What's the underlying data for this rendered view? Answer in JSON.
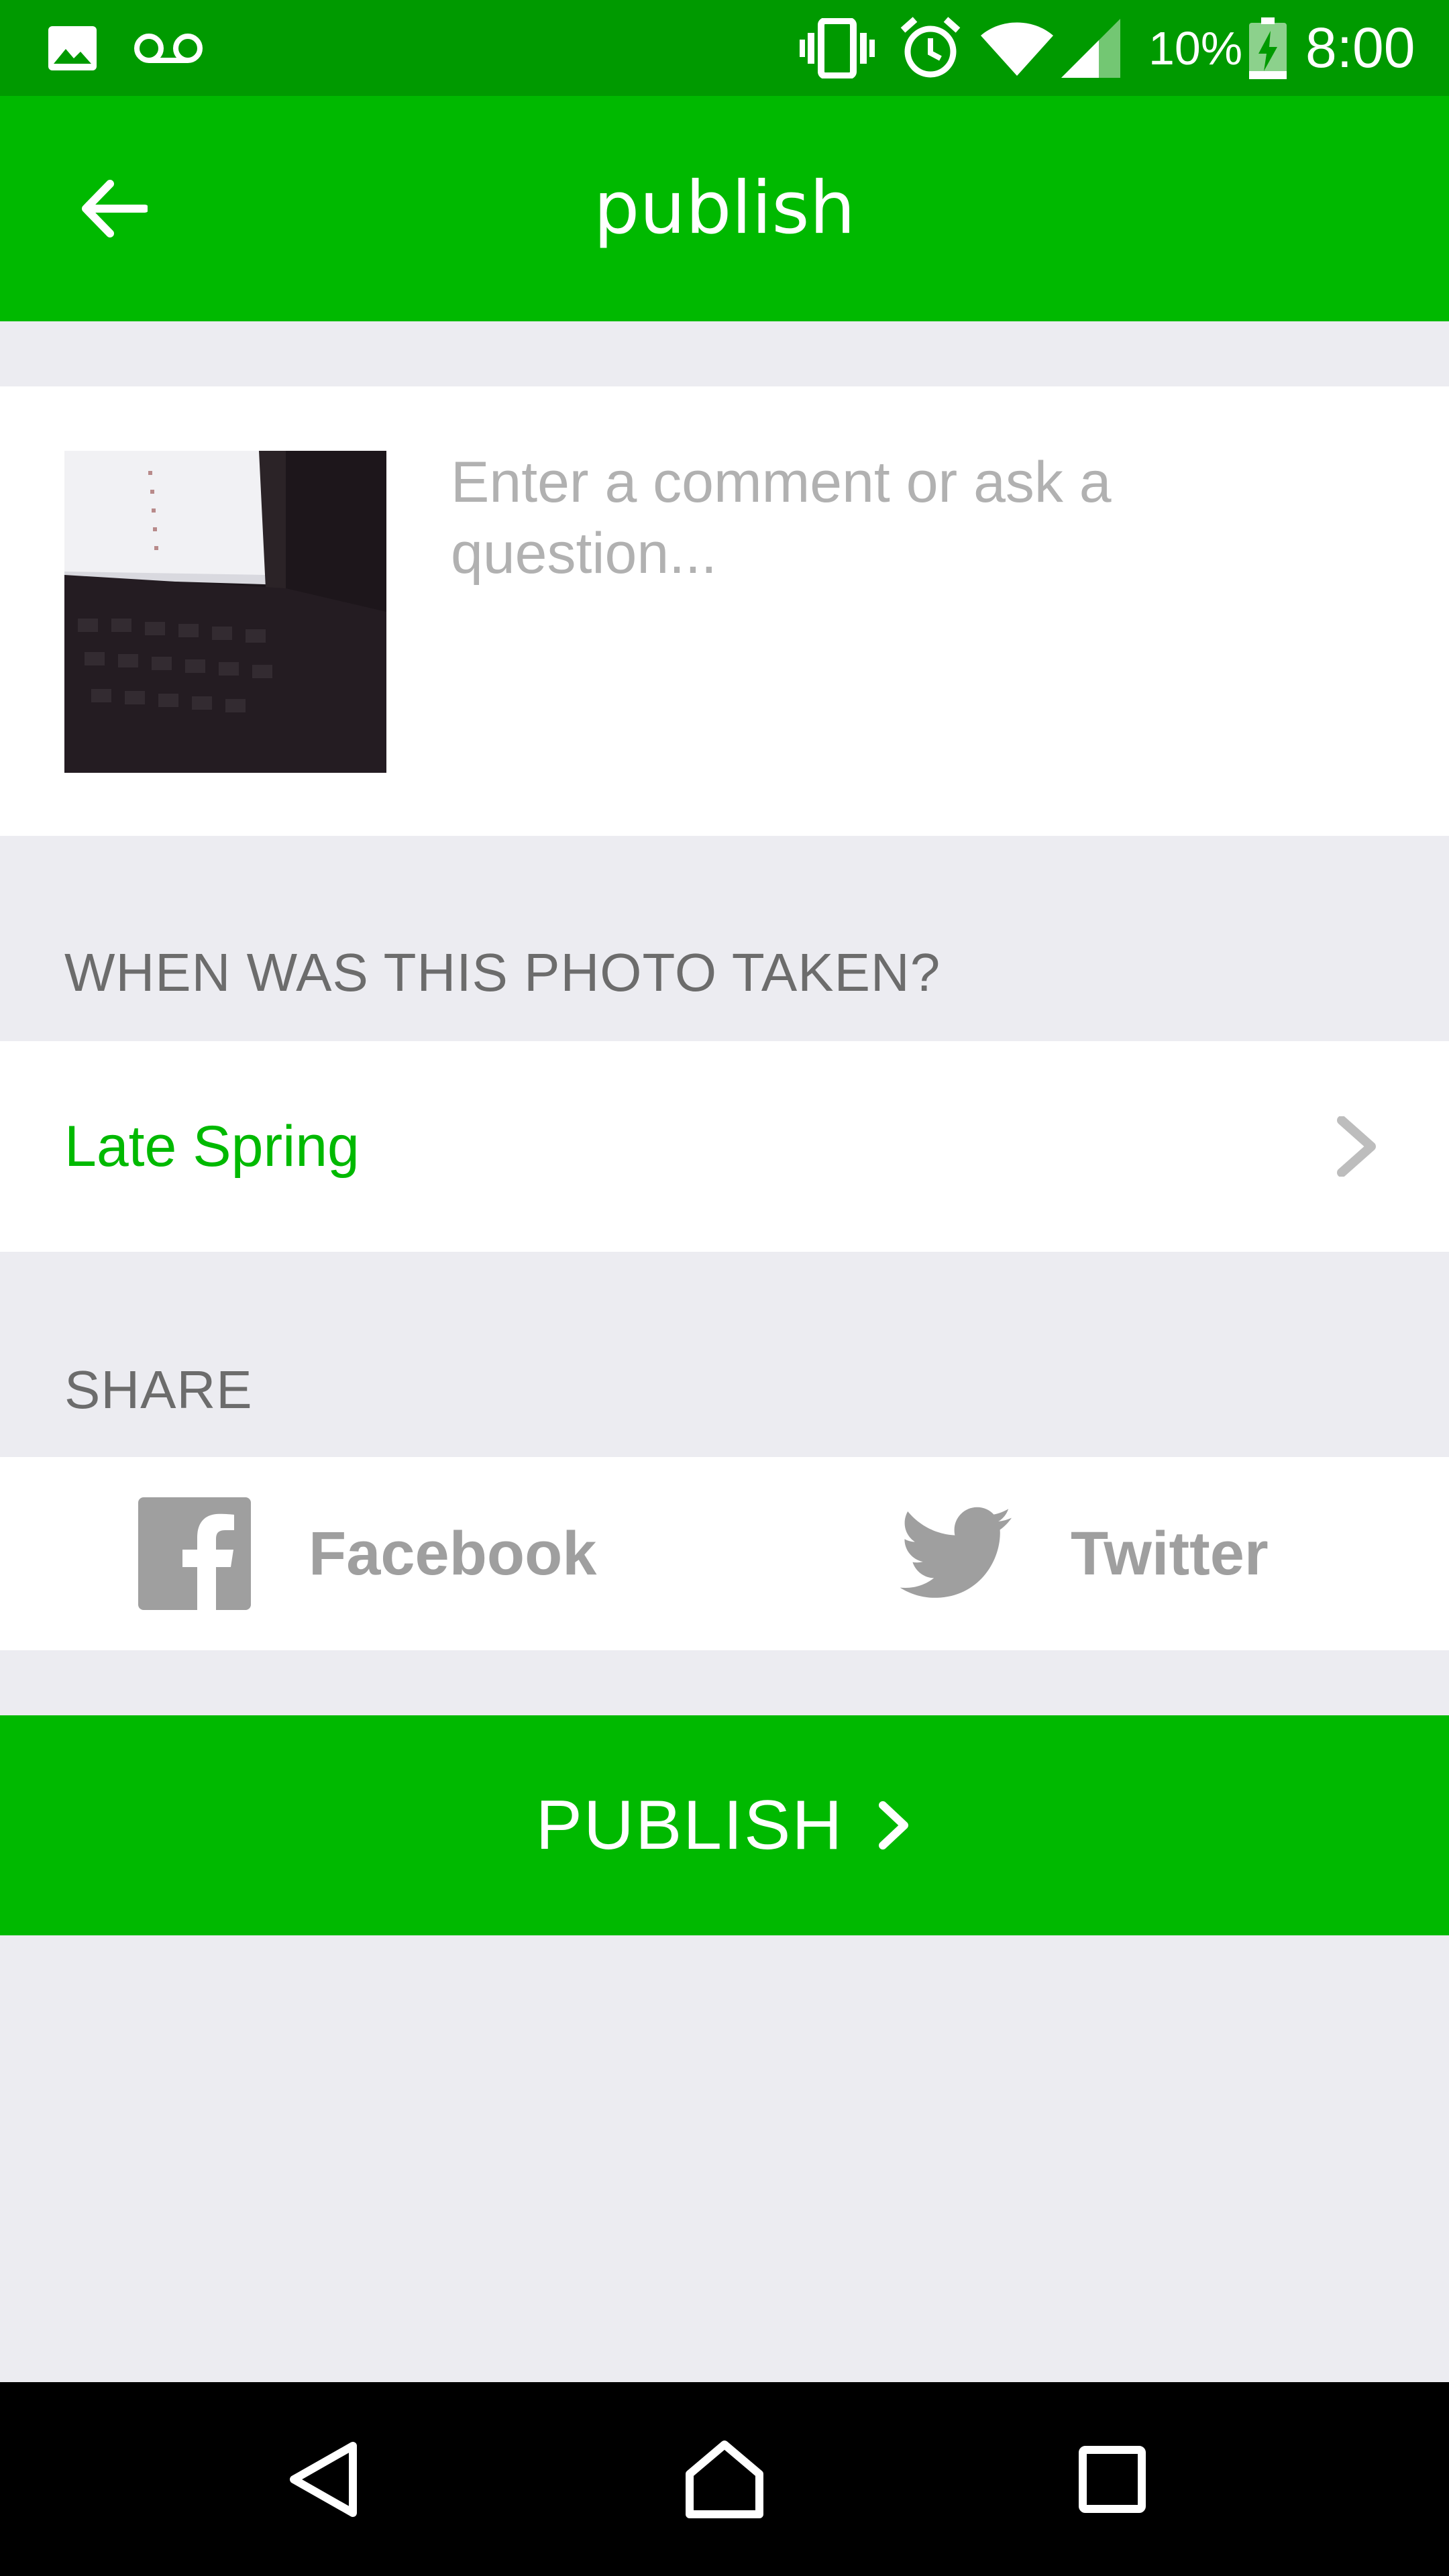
{
  "status_bar": {
    "battery_percent": "10%",
    "time": "8:00",
    "icons": [
      "image-icon",
      "voicemail-icon",
      "vibrate-icon",
      "alarm-icon",
      "wifi-icon",
      "signal-icon",
      "battery-charging-icon"
    ]
  },
  "app_bar": {
    "title": "publish",
    "back_icon": "arrow-left-icon"
  },
  "comment": {
    "value": "",
    "placeholder": "Enter a comment or ask a question..."
  },
  "date_section": {
    "label": "WHEN WAS THIS PHOTO TAKEN?",
    "value": "Late Spring"
  },
  "share_section": {
    "label": "SHARE",
    "facebook_label": "Facebook",
    "twitter_label": "Twitter"
  },
  "publish": {
    "label": "PUBLISH"
  },
  "colors": {
    "brand_green": "#00b900",
    "status_green": "#009a00",
    "background": "#ececf1",
    "share_gray": "#9f9f9f"
  }
}
